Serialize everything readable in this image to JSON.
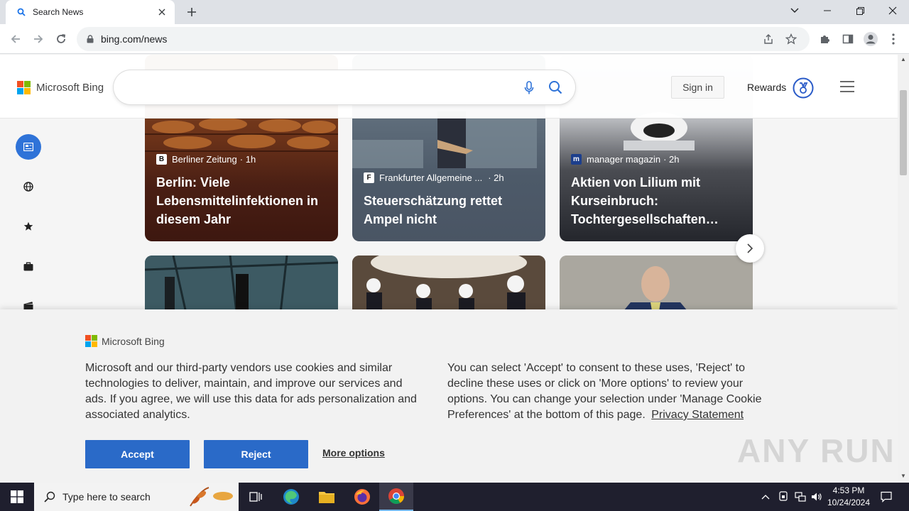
{
  "browser": {
    "tab_title": "Search News",
    "url": "bing.com/news"
  },
  "header": {
    "brand": "Microsoft Bing",
    "search_placeholder": "",
    "signin_label": "Sign in",
    "rewards_label": "Rewards"
  },
  "cards": [
    {
      "source": "Berliner Zeitung",
      "time": "· 1h",
      "headline": "Berlin: Viele Lebensmittelinfektionen in diesem Jahr"
    },
    {
      "source": "Frankfurter Allgemeine ...",
      "time": "· 2h",
      "headline": "Steuerschätzung rettet Ampel nicht"
    },
    {
      "source": "manager magazin",
      "time": "· 2h",
      "headline": "Aktien von Lilium mit Kurseinbruch: Tochtergesellschaften…"
    }
  ],
  "cookie": {
    "brand": "Microsoft Bing",
    "text_left": "Microsoft and our third-party vendors use cookies and similar technologies to deliver, maintain, and improve our services and ads. If you agree, we will use this data for ads personalization and associated analytics.",
    "text_right": "You can select 'Accept' to consent to these uses, 'Reject' to decline these uses or click on 'More options' to review your options. You can change your selection under 'Manage Cookie Preferences' at the bottom of this page.",
    "privacy_label": "Privacy Statement",
    "accept_label": "Accept",
    "reject_label": "Reject",
    "more_options_label": "More options"
  },
  "watermark": "ANY RUN",
  "taskbar": {
    "search_placeholder": "Type here to search",
    "time": "4:53 PM",
    "date": "10/24/2024"
  },
  "colors": {
    "accent": "#2a6ac8",
    "rail_active": "#2f73d8",
    "card1_bg": "#4a1f14",
    "card2_bg": "#4d5a69",
    "card3_bg": "#24262c"
  }
}
